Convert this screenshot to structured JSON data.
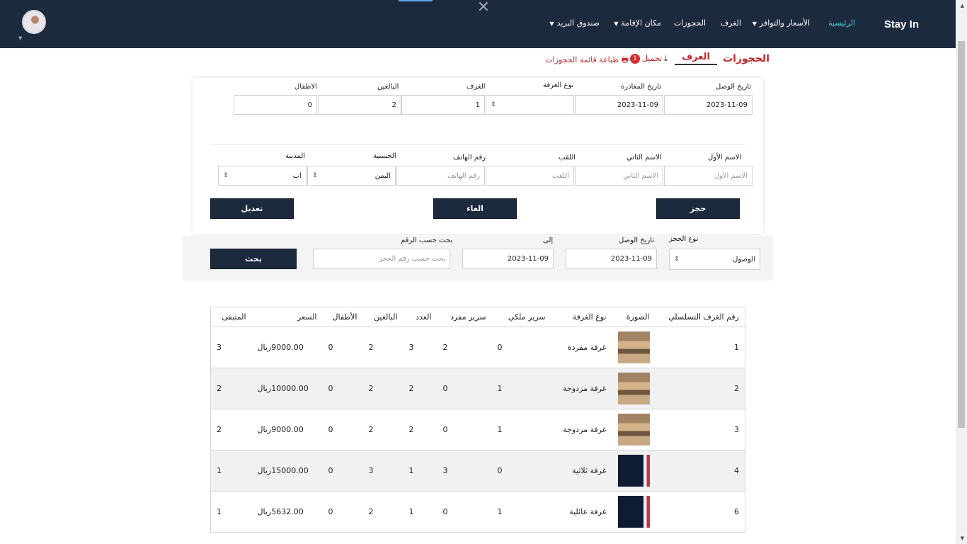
{
  "nav": {
    "brand": "Stay In",
    "items": [
      {
        "label": "الرئيسية",
        "active": true
      },
      {
        "label": "الأسعار والتوافر",
        "dropdown": true
      },
      {
        "label": "الغرف",
        "dropdown": false
      },
      {
        "label": "الحجوزات",
        "dropdown": false
      },
      {
        "label": "مكان الإقامة",
        "dropdown": true
      },
      {
        "label": "صندوق البريد",
        "dropdown": true
      }
    ]
  },
  "header": {
    "bookings": "الحجوزات",
    "rooms": "الغرف",
    "download": "تحميل",
    "badge_count": "1",
    "print": "طباعة قائمة الحجوزات"
  },
  "booking_form": {
    "arrival_label": "تاريخ الوصل",
    "arrival_value": "2023-11-09",
    "departure_label": "تاريخ المغادرة",
    "departure_value": "2023-11-09",
    "room_type_label": "نوع الغرفة",
    "room_type_value": "",
    "rooms_label": "الغرف",
    "rooms_value": "1",
    "adults_label": "البالغين",
    "adults_value": "2",
    "children_label": "الاطفال",
    "children_value": "0",
    "first_name_label": "الاسم الأول",
    "first_name_placeholder": "الاسم الأول",
    "second_name_label": "الاسم الثاني",
    "second_name_placeholder": "الاسم الثاني",
    "surname_label": "اللقب",
    "surname_placeholder": "اللقب",
    "phone_label": "رقم الهاتف",
    "phone_placeholder": "رقم الهاتف",
    "nationality_label": "الجنسية",
    "nationality_value": "اليمن",
    "city_label": "المدينة",
    "city_value": "اب",
    "book_button": "حجز",
    "cancel_button": "الغاء",
    "edit_button": "تعديل"
  },
  "search": {
    "type_label": "نوع الحجز",
    "type_value": "الوصول",
    "arrival_label": "تاريخ الوصل",
    "arrival_value": "2023-11-09",
    "to_label": "إلى",
    "to_value": "2023-11-09",
    "number_label": "بحث حسب الرقم",
    "number_placeholder": "بحث حسب رقم الحجز",
    "search_button": "بحث"
  },
  "table": {
    "headers": [
      "رقم الغرف التسلسلي",
      "الصورة",
      "نوع الغرفة",
      "سرير ملكي",
      "سرير مفرد",
      "العدد",
      "البالغين",
      "الأطفال",
      "السعر",
      "المتبقى"
    ],
    "rows": [
      {
        "id": "1",
        "image": "room",
        "type": "غرفة مفردة",
        "king": "0",
        "single": "2",
        "count": "3",
        "adults": "2",
        "children": "0",
        "price": "9000.00ريال",
        "remaining": "3"
      },
      {
        "id": "2",
        "image": "room",
        "type": "غرفة مزدوجة",
        "king": "1",
        "single": "0",
        "count": "2",
        "adults": "2",
        "children": "0",
        "price": "10000.00ريال",
        "remaining": "2"
      },
      {
        "id": "3",
        "image": "room",
        "type": "غرفة مزدوجة",
        "king": "1",
        "single": "0",
        "count": "2",
        "adults": "2",
        "children": "0",
        "price": "9000.00ريال",
        "remaining": "2"
      },
      {
        "id": "4",
        "image": "screen",
        "type": "غرفة ثلاثية",
        "king": "0",
        "single": "3",
        "count": "1",
        "adults": "3",
        "children": "0",
        "price": "15000.00ريال",
        "remaining": "1"
      },
      {
        "id": "6",
        "image": "screen",
        "type": "غرفة عائلية",
        "king": "1",
        "single": "0",
        "count": "1",
        "adults": "2",
        "children": "0",
        "price": "5632.00ريال",
        "remaining": "1"
      }
    ]
  },
  "colors": {
    "nav_bg": "#1c2a3e",
    "accent_red": "#c0282d",
    "active_nav": "#4fd1d9"
  }
}
